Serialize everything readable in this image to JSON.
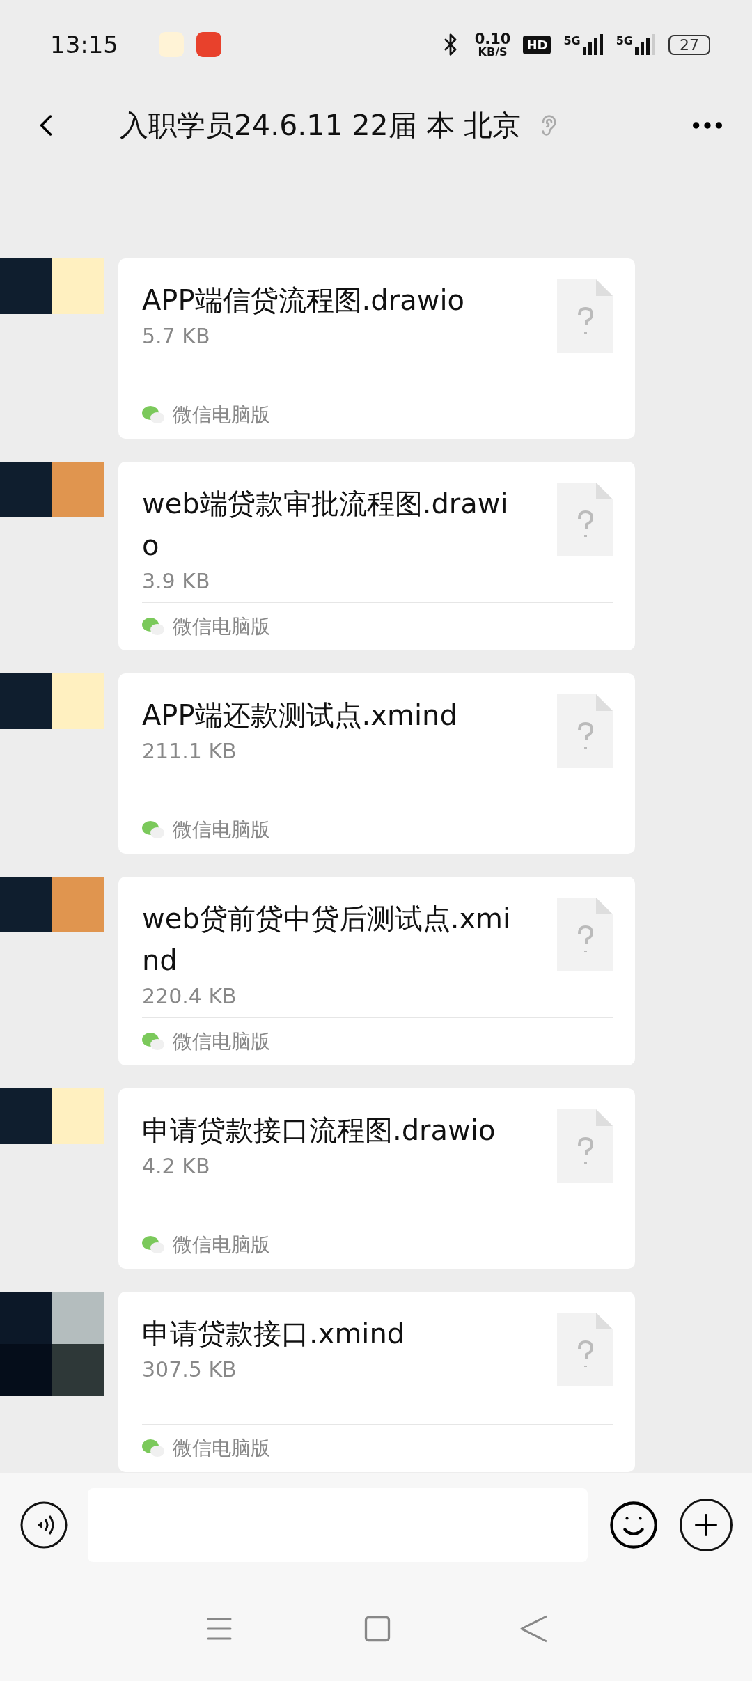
{
  "status_bar": {
    "time": "13:15",
    "net_speed": "0.10",
    "net_unit": "KB/S",
    "hd": "HD",
    "signal_1": "5G",
    "signal_2": "5G",
    "battery": "27"
  },
  "header": {
    "title": "入职学员24.6.11 22届 本 北京"
  },
  "messages": [
    {
      "name": "APP端信贷流程图.drawio",
      "size": "5.7 KB",
      "source": "微信电脑版"
    },
    {
      "name": "web端贷款审批流程图.drawio",
      "size": "3.9 KB",
      "source": "微信电脑版"
    },
    {
      "name": "APP端还款测试点.xmind",
      "size": "211.1 KB",
      "source": "微信电脑版"
    },
    {
      "name": "web贷前贷中贷后测试点.xmind",
      "size": "220.4 KB",
      "source": "微信电脑版"
    },
    {
      "name": "申请贷款接口流程图.drawio",
      "size": "4.2 KB",
      "source": "微信电脑版"
    },
    {
      "name": "申请贷款接口.xmind",
      "size": "307.5 KB",
      "source": "微信电脑版"
    }
  ]
}
